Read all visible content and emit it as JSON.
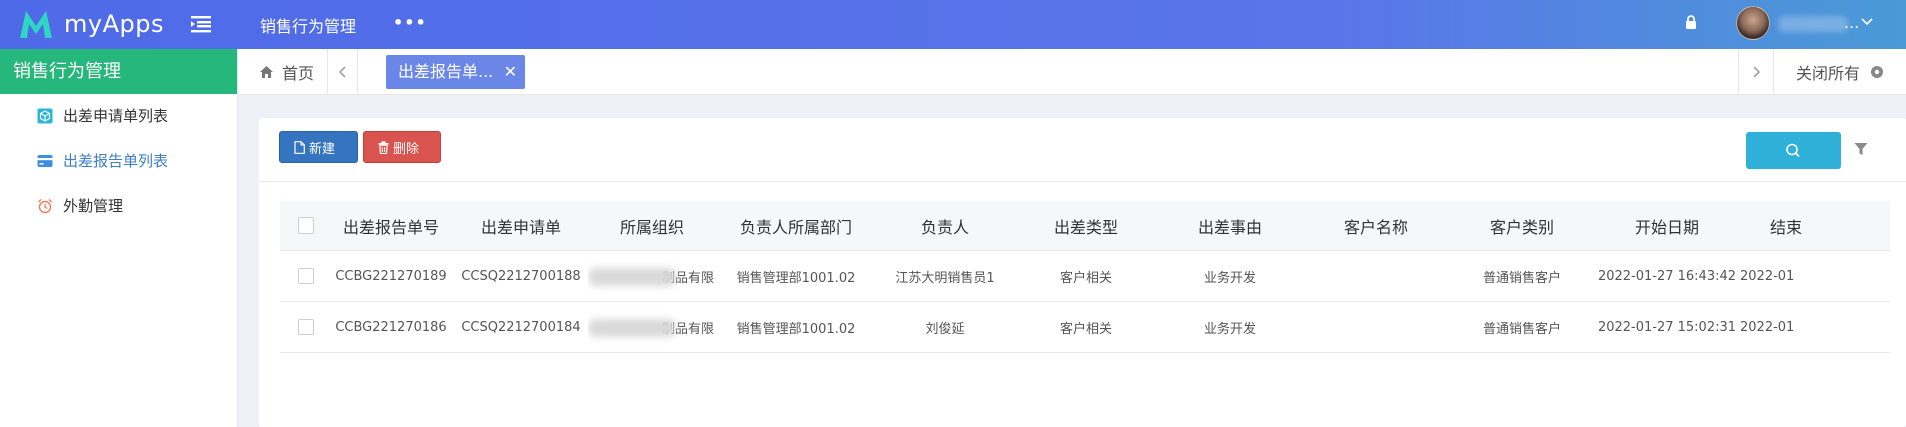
{
  "header": {
    "logo_text": "myApps",
    "module_title": "销售行为管理",
    "more": "•••",
    "user_suffix": "...",
    "colors": {
      "primary": "#4f6ae8",
      "accent_green": "#25b77b"
    }
  },
  "sidebar": {
    "title": "销售行为管理",
    "items": [
      {
        "label": "出差申请单列表",
        "icon": "cube-icon"
      },
      {
        "label": "出差报告单列表",
        "icon": "card-icon",
        "active": true
      },
      {
        "label": "外勤管理",
        "icon": "alarm-clock-icon"
      }
    ]
  },
  "tabs": {
    "home": "首页",
    "active": "出差报告单...",
    "close_glyph": "✕",
    "close_all": "关闭所有"
  },
  "toolbar": {
    "new_label": "新建",
    "delete_label": "删除"
  },
  "table": {
    "columns": [
      "出差报告单号",
      "出差申请单",
      "所属组织",
      "负责人所属部门",
      "负责人",
      "出差类型",
      "出差事由",
      "客户名称",
      "客户类别",
      "开始日期",
      "结束"
    ],
    "rows": [
      [
        "CCBG221270189",
        "CCSQ2212700188",
        "制品有限",
        "销售管理部1001.02",
        "江苏大明销售员1",
        "客户相关",
        "业务开发",
        "",
        "普通销售客户",
        "2022-01-27 16:43:42",
        "2022-01"
      ],
      [
        "CCBG221270186",
        "CCSQ2212700184",
        "制品有限",
        "销售管理部1001.02",
        "刘俊延",
        "客户相关",
        "业务开发",
        "",
        "普通销售客户",
        "2022-01-27 15:02:31",
        "2022-01"
      ]
    ]
  }
}
